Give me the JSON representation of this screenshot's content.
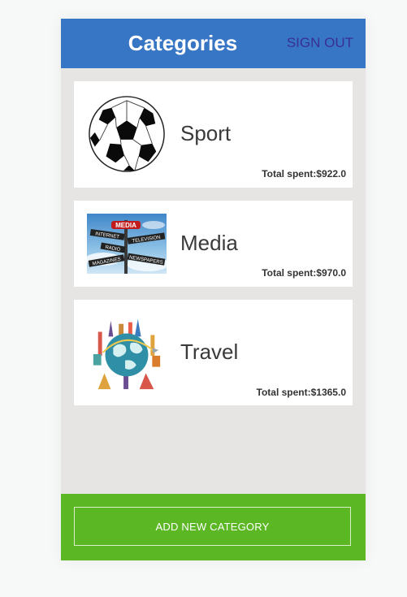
{
  "header": {
    "title": "Categories",
    "sign_out_label": "SIGN OUT"
  },
  "categories": [
    {
      "name": "Sport",
      "total_label": "Total spent:",
      "total_value": "$922.0",
      "icon": "soccer-ball-icon"
    },
    {
      "name": "Media",
      "total_label": "Total spent:",
      "total_value": "$970.0",
      "icon": "media-signpost-image"
    },
    {
      "name": "Travel",
      "total_label": "Total spent:",
      "total_value": "$1365.0",
      "icon": "travel-globe-image"
    }
  ],
  "media_sign": {
    "top": "MEDIA",
    "left1": "INTERNET",
    "right1": "TELEVISION",
    "left2": "RADIO",
    "left3": "MAGAZINES",
    "right2": "NEWSPAPERS"
  },
  "footer": {
    "add_label": "ADD NEW CATEGORY"
  },
  "colors": {
    "header": "#3776c4",
    "sign_out": "#3a2f93",
    "footer": "#5cb725",
    "list_background": "#e6e5e4"
  }
}
